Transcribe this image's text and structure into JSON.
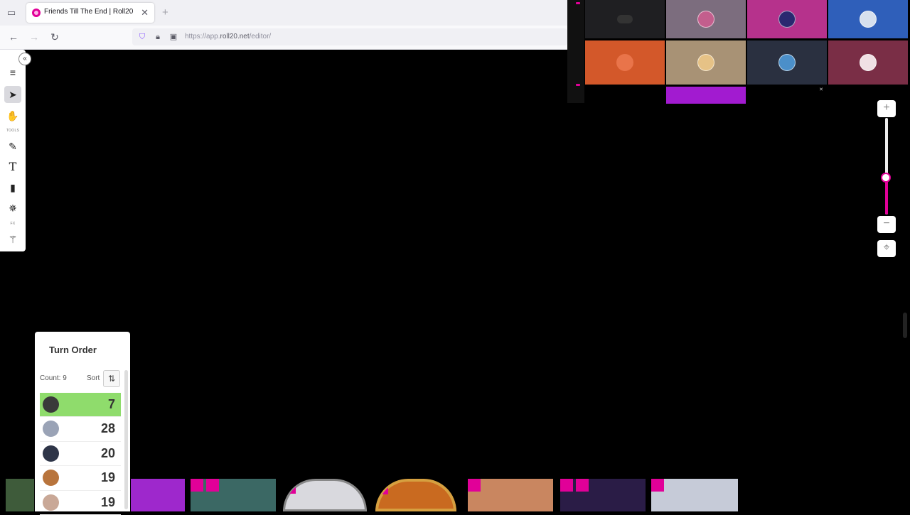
{
  "browser": {
    "tab_title": "Friends Till The End | Roll20",
    "tab_close": "✕",
    "new_tab": "+",
    "url_prefix": "https://app.",
    "url_domain": "roll20.net",
    "url_path": "/editor/",
    "icons": [
      "tab-list-icon",
      "back-icon",
      "forward-icon",
      "reload-icon",
      "shield-icon",
      "lock-icon",
      "page-icon"
    ]
  },
  "toolbar": {
    "collapse": "«",
    "tools": [
      {
        "name": "menu-icon",
        "glyph": "≡"
      },
      {
        "name": "select-icon",
        "glyph": "➤"
      },
      {
        "name": "pan-hand-icon",
        "glyph": "✋"
      },
      {
        "name": "draw-brush-icon",
        "glyph": "✎"
      },
      {
        "name": "text-icon",
        "glyph": "T"
      },
      {
        "name": "ruler-icon",
        "glyph": "▮"
      },
      {
        "name": "dice-icon",
        "glyph": "✵"
      },
      {
        "name": "magic-wand-icon",
        "glyph": "⚚"
      }
    ],
    "tools_label": "TOOLS",
    "fx_label": "FX"
  },
  "video": {
    "tile_colors": [
      "#1f1f22",
      "#7c6d7e",
      "#b6328c",
      "#2f5fba",
      "#d3582a",
      "#a89275",
      "#2a3040",
      "#7a2e46"
    ],
    "bottom_tile_color": "#a21bd0",
    "accent": "#e10098"
  },
  "zoom": {
    "plus": "+",
    "minus": "−",
    "reset": "⌖",
    "level": 0.38
  },
  "turn_order": {
    "title": "Turn Order",
    "count_label": "Count:",
    "count": "9",
    "sort_label": "Sort",
    "sort_icon": "⇅",
    "rows": [
      {
        "value": "7",
        "current": true,
        "avatar": "#3a3a3a"
      },
      {
        "value": "28",
        "current": false,
        "avatar": "#9aa3b6"
      },
      {
        "value": "20",
        "current": false,
        "avatar": "#2e3548"
      },
      {
        "value": "19",
        "current": false,
        "avatar": "#b8743c"
      },
      {
        "value": "19",
        "current": false,
        "avatar": "#c9a897"
      }
    ]
  },
  "tokens": [
    {
      "color": "#3e5b3a"
    },
    {
      "color": "#9e28cc"
    },
    {
      "color": "#3b6864"
    },
    {
      "color": "#d9d9de"
    },
    {
      "color": "#c96a20"
    },
    {
      "color": "#c98660"
    },
    {
      "color": "#2a1c46"
    },
    {
      "color": "#c6cbd8"
    }
  ]
}
